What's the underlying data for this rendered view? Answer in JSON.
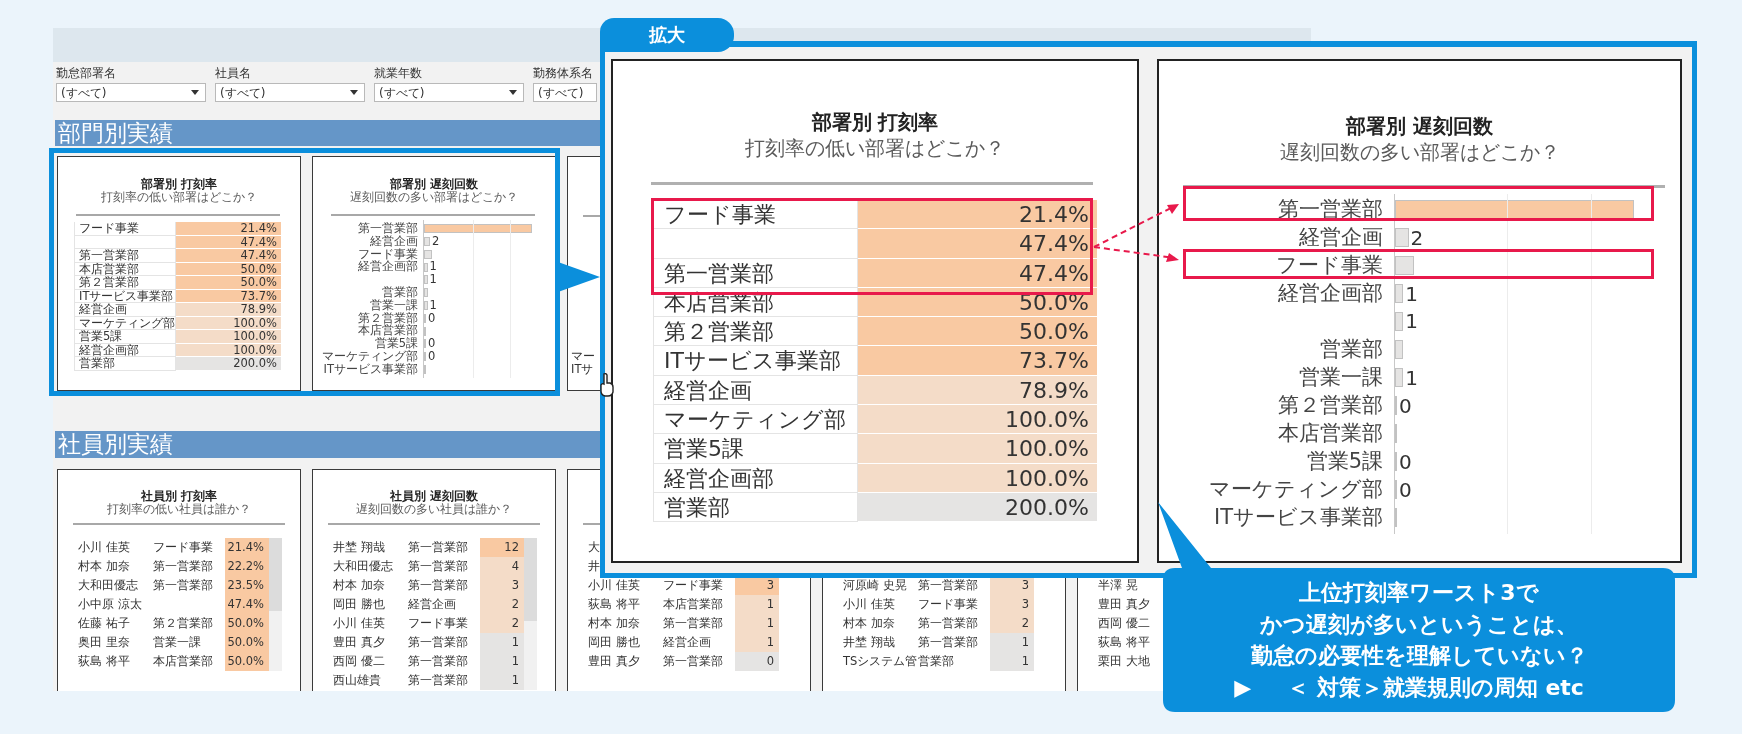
{
  "dashboard": {
    "filters": [
      {
        "label": "勤怠部署名",
        "value": "(すべて)"
      },
      {
        "label": "社員名",
        "value": "(すべて)"
      },
      {
        "label": "就業年数",
        "value": "(すべて)"
      },
      {
        "label": "勤務体系名",
        "value": "(すべて)"
      }
    ],
    "sections": [
      {
        "title": "部門別実績",
        "cards": [
          {
            "kind": "rate_table",
            "title": "部署別 打刻率",
            "subtitle": "打刻率の低い部署はどこか？",
            "rows": [
              {
                "name": "フード事業",
                "value": "21.4%",
                "kind": "high"
              },
              {
                "value": "47.4%",
                "kind": "high"
              },
              {
                "name": "第一営業部",
                "value": "47.4%",
                "kind": "high"
              },
              {
                "name": "本店営業部",
                "value": "50.0%",
                "kind": "high"
              },
              {
                "name": "第２営業部",
                "value": "50.0%",
                "kind": "high"
              },
              {
                "name": "ITサービス事業部",
                "value": "73.7%",
                "kind": "high"
              },
              {
                "name": "経営企画",
                "value": "78.9%",
                "kind": "mid"
              },
              {
                "name": "マーケティング部",
                "value": "100.0%",
                "kind": "mid"
              },
              {
                "name": "営業5課",
                "value": "100.0%",
                "kind": "mid"
              },
              {
                "name": "経営企画部",
                "value": "100.0%",
                "kind": "mid"
              },
              {
                "name": "営業部",
                "value": "200.0%",
                "kind": "low"
              }
            ]
          },
          {
            "kind": "bar_list",
            "title": "部署別 遅刻回数",
            "subtitle": "遅刻回数の多い部署はどこか？",
            "rows": [
              {
                "label": "第一営業部",
                "level": 0.9,
                "kind": "high"
              },
              {
                "label": "経営企画",
                "level": 0.05,
                "reading": "2",
                "kind": "low"
              },
              {
                "label": "フード事業",
                "level": 0.07,
                "kind": "low"
              },
              {
                "label": "経営企画部",
                "level": 0.03,
                "reading": "1",
                "kind": "low"
              },
              {
                "level": 0.03,
                "reading": "1",
                "kind": "low"
              },
              {
                "label": "営業部",
                "level": 0.03,
                "kind": "low"
              },
              {
                "label": "営業一課",
                "level": 0.03,
                "reading": "1",
                "kind": "low"
              },
              {
                "label": "第２営業部",
                "level": 0,
                "reading": "0"
              },
              {
                "label": "本店営業部",
                "level": 0
              },
              {
                "label": "営業5課",
                "level": 0,
                "reading": "0"
              },
              {
                "label": "マーケティング部",
                "level": 0,
                "reading": "0"
              },
              {
                "label": "ITサービス事業部",
                "level": 0
              }
            ]
          },
          {
            "kind": "fragments",
            "texts": [
              "マー",
              "ITサ"
            ]
          }
        ]
      },
      {
        "title": "社員別実績",
        "cards": [
          {
            "kind": "employee_table",
            "title": "社員別 打刻率",
            "subtitle": "打刻率の低い社員は誰か？",
            "rows": [
              {
                "name": "小川 佳英",
                "dept": "フード事業",
                "value": "21.4%",
                "kind": "high"
              },
              {
                "name": "村本 加奈",
                "dept": "第一営業部",
                "value": "22.2%",
                "kind": "high"
              },
              {
                "name": "大和田優志",
                "dept": "第一営業部",
                "value": "23.5%",
                "kind": "high"
              },
              {
                "name": "小中原 涼太",
                "value": "47.4%",
                "kind": "high"
              },
              {
                "name": "佐藤 祐子",
                "dept": "第２営業部",
                "value": "50.0%",
                "kind": "high"
              },
              {
                "name": "奥田 里奈",
                "dept": "営業一課",
                "value": "50.0%",
                "kind": "high"
              },
              {
                "name": "荻島 将平",
                "dept": "本店営業部",
                "value": "50.0%",
                "kind": "high"
              }
            ]
          },
          {
            "kind": "employee_table",
            "title": "社員別 遅刻回数",
            "subtitle": "遅刻回数の多い社員は誰か？",
            "rows": [
              {
                "name": "井埜 翔哉",
                "dept": "第一営業部",
                "value": "12",
                "kind": "high"
              },
              {
                "name": "大和田優志",
                "dept": "第一営業部",
                "value": "4",
                "kind": "mid"
              },
              {
                "name": "村本 加奈",
                "dept": "第一営業部",
                "value": "3",
                "kind": "mid"
              },
              {
                "name": "岡田 勝也",
                "dept": "経営企画",
                "value": "2",
                "kind": "mid"
              },
              {
                "name": "小川 佳英",
                "dept": "フード事業",
                "value": "2",
                "kind": "mid"
              },
              {
                "name": "豊田 真夕",
                "dept": "第一営業部",
                "value": "1",
                "kind": "low"
              },
              {
                "name": "西岡 優二",
                "dept": "第一営業部",
                "value": "1",
                "kind": "low"
              },
              {
                "name": "西山雄貴",
                "dept": "第一営業部",
                "value": "1",
                "kind": "low"
              }
            ]
          },
          {
            "kind": "employee_table",
            "rows": [
              {
                "name": "大"
              },
              {
                "name": "井"
              },
              {
                "name": "小川 佳英",
                "dept": "フード事業",
                "value": "3",
                "kind": "high"
              },
              {
                "name": "荻島 将平",
                "dept": "本店営業部",
                "value": "1",
                "kind": "mid"
              },
              {
                "name": "村本 加奈",
                "dept": "第一営業部",
                "value": "1",
                "kind": "mid"
              },
              {
                "name": "岡田 勝也",
                "dept": "経営企画",
                "value": "1",
                "kind": "mid"
              },
              {
                "name": "豊田 真夕",
                "dept": "第一営業部",
                "value": "0",
                "kind": "low"
              }
            ]
          },
          {
            "kind": "employee_table_tail",
            "rows": [
              {
                "name": "河原崎 史晃",
                "dept": "第一営業部",
                "value": "3",
                "kind": "mid"
              },
              {
                "name": "小川 佳英",
                "dept": "フード事業",
                "value": "3",
                "kind": "mid"
              },
              {
                "name": "村本 加奈",
                "dept": "第一営業部",
                "value": "2",
                "kind": "mid"
              },
              {
                "name": "井埜 翔哉",
                "dept": "第一営業部",
                "value": "1",
                "kind": "low"
              },
              {
                "name": "TSシステム管",
                "dept": "営業部",
                "value": "1",
                "kind": "low"
              }
            ]
          },
          {
            "kind": "employee_table_tail",
            "rows": [
              {
                "name": "半澤 晃"
              },
              {
                "name": "豊田 真夕"
              },
              {
                "name": "西岡 優二"
              },
              {
                "name": "荻島 将平"
              },
              {
                "name": "栗田 大地"
              }
            ]
          }
        ]
      }
    ]
  },
  "zoom_panel": {
    "label": "拡大",
    "cards": [
      {
        "kind": "rate_table",
        "title": "部署別 打刻率",
        "subtitle": "打刻率の低い部署はどこか？",
        "rows": [
          {
            "name": "フード事業",
            "value": "21.4%",
            "kind": "high"
          },
          {
            "value": "47.4%",
            "kind": "high"
          },
          {
            "name": "第一営業部",
            "value": "47.4%",
            "kind": "high"
          },
          {
            "name": "本店営業部",
            "value": "50.0%",
            "kind": "high"
          },
          {
            "name": "第２営業部",
            "value": "50.0%",
            "kind": "high"
          },
          {
            "name": "ITサービス事業部",
            "value": "73.7%",
            "kind": "high"
          },
          {
            "name": "経営企画",
            "value": "78.9%",
            "kind": "mid"
          },
          {
            "name": "マーケティング部",
            "value": "100.0%",
            "kind": "mid"
          },
          {
            "name": "営業5課",
            "value": "100.0%",
            "kind": "mid"
          },
          {
            "name": "経営企画部",
            "value": "100.0%",
            "kind": "mid"
          },
          {
            "name": "営業部",
            "value": "200.0%",
            "kind": "low"
          }
        ]
      },
      {
        "kind": "bar_list",
        "title": "部署別 遅刻回数",
        "subtitle": "遅刻回数の多い部署はどこか？",
        "rows": [
          {
            "label": "第一営業部",
            "level": 0.88,
            "kind": "high"
          },
          {
            "label": "経営企画",
            "level": 0.05,
            "reading": "2",
            "kind": "low"
          },
          {
            "label": "フード事業",
            "level": 0.07,
            "kind": "low"
          },
          {
            "label": "経営企画部",
            "level": 0.03,
            "reading": "1",
            "kind": "low"
          },
          {
            "level": 0.03,
            "reading": "1",
            "kind": "low"
          },
          {
            "label": "営業部",
            "level": 0.03,
            "kind": "low"
          },
          {
            "label": "営業一課",
            "level": 0.03,
            "reading": "1",
            "kind": "low"
          },
          {
            "label": "第２営業部",
            "level": 0,
            "reading": "0"
          },
          {
            "label": "本店営業部",
            "level": 0
          },
          {
            "label": "営業5課",
            "level": 0,
            "reading": "0"
          },
          {
            "label": "マーケティング部",
            "level": 0,
            "reading": "0"
          },
          {
            "label": "ITサービス事業部",
            "level": 0
          }
        ]
      }
    ]
  },
  "callout": {
    "lines": [
      "上位打刻率ワースト3で",
      "かつ遅刻が多いということは、",
      "勤怠の必要性を理解していない？"
    ],
    "action": {
      "marker": "▶",
      "text": "＜ 対策＞就業規則の周知 etc"
    }
  }
}
